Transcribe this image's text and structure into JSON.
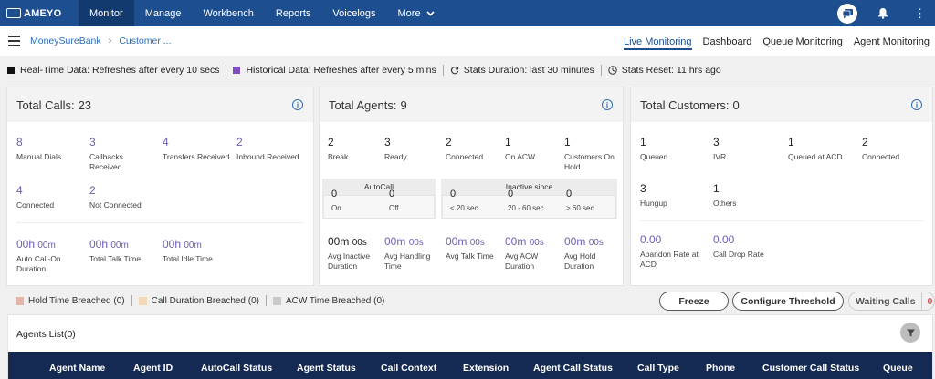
{
  "brand": {
    "name": "AMEYO"
  },
  "nav": {
    "items": [
      "Monitor",
      "Manage",
      "Workbench",
      "Reports",
      "Voicelogs",
      "More"
    ],
    "active": "Monitor"
  },
  "breadcrumb": {
    "first": "MoneySureBank",
    "second": "Customer ..."
  },
  "tabs": [
    "Live Monitoring",
    "Dashboard",
    "Queue Monitoring",
    "Agent Monitoring"
  ],
  "infobar": {
    "realtime": "Real-Time Data: Refreshes after every 10 secs",
    "historical": "Historical Data: Refreshes after every 5 mins",
    "duration": "Stats Duration: last 30 minutes",
    "reset": "Stats Reset: 11 hrs ago",
    "realtime_color": "#111111",
    "historical_color": "#7b4fc0"
  },
  "calls": {
    "title": "Total Calls:",
    "count": "23",
    "manual_dials": {
      "value": "8",
      "label": "Manual Dials"
    },
    "callbacks": {
      "value": "3",
      "label": "Callbacks Received"
    },
    "transfers": {
      "value": "4",
      "label": "Transfers Received"
    },
    "inbound": {
      "value": "2",
      "label": "Inbound Received"
    },
    "connected": {
      "value": "4",
      "label": "Connected"
    },
    "not_connected": {
      "value": "2",
      "label": "Not Connected"
    },
    "autocall_on": {
      "h": "00h",
      "m": "00m",
      "label": "Auto Call-On Duration"
    },
    "talk_time": {
      "h": "00h",
      "m": "00m",
      "label": "Total Talk Time"
    },
    "idle_time": {
      "h": "00h",
      "m": "00m",
      "label": "Total Idle Time"
    }
  },
  "agents": {
    "title": "Total Agents:",
    "count": "9",
    "break": {
      "value": "2",
      "label": "Break"
    },
    "ready": {
      "value": "3",
      "label": "Ready"
    },
    "connected": {
      "value": "2",
      "label": "Connected"
    },
    "on_acw": {
      "value": "1",
      "label": "On ACW"
    },
    "on_hold": {
      "value": "1",
      "label": "Customers On Hold"
    },
    "autocall": {
      "title": "AutoCall",
      "on": {
        "value": "0",
        "label": "On"
      },
      "off": {
        "value": "0",
        "label": "Off"
      }
    },
    "inactive": {
      "title": "Inactive since",
      "lt20": {
        "value": "0",
        "label": "< 20 sec"
      },
      "b2060": {
        "value": "0",
        "label": "20 - 60 sec"
      },
      "gt60": {
        "value": "0",
        "label": "> 60 sec"
      }
    },
    "avg_inactive": {
      "m": "00m",
      "s": "00s",
      "label": "Avg Inactive Duration"
    },
    "avg_handling": {
      "m": "00m",
      "s": "00s",
      "label": "Avg Handling Time"
    },
    "avg_talk": {
      "m": "00m",
      "s": "00s",
      "label": "Avg Talk Time"
    },
    "avg_acw": {
      "m": "00m",
      "s": "00s",
      "label": "Avg ACW Duration"
    },
    "avg_hold": {
      "m": "00m",
      "s": "00s",
      "label": "Avg Hold Duration"
    }
  },
  "customers": {
    "title": "Total Customers:",
    "count": "0",
    "queued": {
      "value": "1",
      "label": "Queued"
    },
    "ivr": {
      "value": "3",
      "label": "IVR"
    },
    "queued_acd": {
      "value": "1",
      "label": "Queued at ACD"
    },
    "connected": {
      "value": "2",
      "label": "Connected"
    },
    "hungup": {
      "value": "3",
      "label": "Hungup"
    },
    "others": {
      "value": "1",
      "label": "Others"
    },
    "abandon_rate": {
      "value": "0.00",
      "label": "Abandon Rate at ACD"
    },
    "call_drop_rate": {
      "value": "0.00",
      "label": "Call Drop Rate"
    }
  },
  "legend": {
    "hold": {
      "label": "Hold Time Breached (0)",
      "color": "#e8b4a8"
    },
    "duration": {
      "label": "Call Duration Breached (0)",
      "color": "#f3d9b6"
    },
    "acw": {
      "label": "ACW Time Breached (0)",
      "color": "#c9c9c9"
    }
  },
  "buttons": {
    "freeze": "Freeze",
    "configure": "Configure Threshold",
    "waiting": "Waiting Calls",
    "waiting_count": "0"
  },
  "agents_list": {
    "title": "Agents List(0)",
    "columns": [
      "Agent Name",
      "Agent ID",
      "AutoCall Status",
      "Agent Status",
      "Call Context",
      "Extension",
      "Agent Call Status",
      "Call Type",
      "Phone",
      "Customer Call Status",
      "Queue"
    ]
  }
}
